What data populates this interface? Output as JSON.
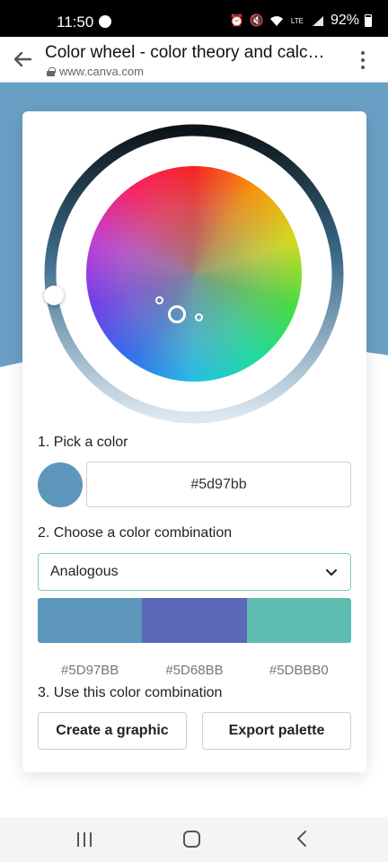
{
  "status_bar": {
    "time": "11:50",
    "battery": "92%",
    "icons": [
      "messenger-icon",
      "alarm-icon",
      "mute-icon",
      "wifi-icon",
      "lte-icon",
      "signal-icon",
      "battery-icon"
    ],
    "lte_label": "LTE"
  },
  "browser": {
    "title": "Color wheel - color theory and calc…",
    "url": "www.canva.com"
  },
  "color_wheel": {
    "selected_hex": "#5d97bb",
    "selected_color": "#5d97bb"
  },
  "steps": {
    "pick": "1. Pick a color",
    "choose": "2. Choose a color combination",
    "use": "3. Use this color combination"
  },
  "combination": {
    "selected": "Analogous"
  },
  "palette": [
    {
      "hex": "#5D97BB",
      "color": "#5d97bb"
    },
    {
      "hex": "#5D68BB",
      "color": "#5d68bb"
    },
    {
      "hex": "#5DBBB0",
      "color": "#5dbbb0"
    }
  ],
  "buttons": {
    "create": "Create a graphic",
    "export": "Export palette"
  },
  "colors": {
    "accent_border": "#7ec8c8",
    "background_blue": "#6a9fc5"
  }
}
